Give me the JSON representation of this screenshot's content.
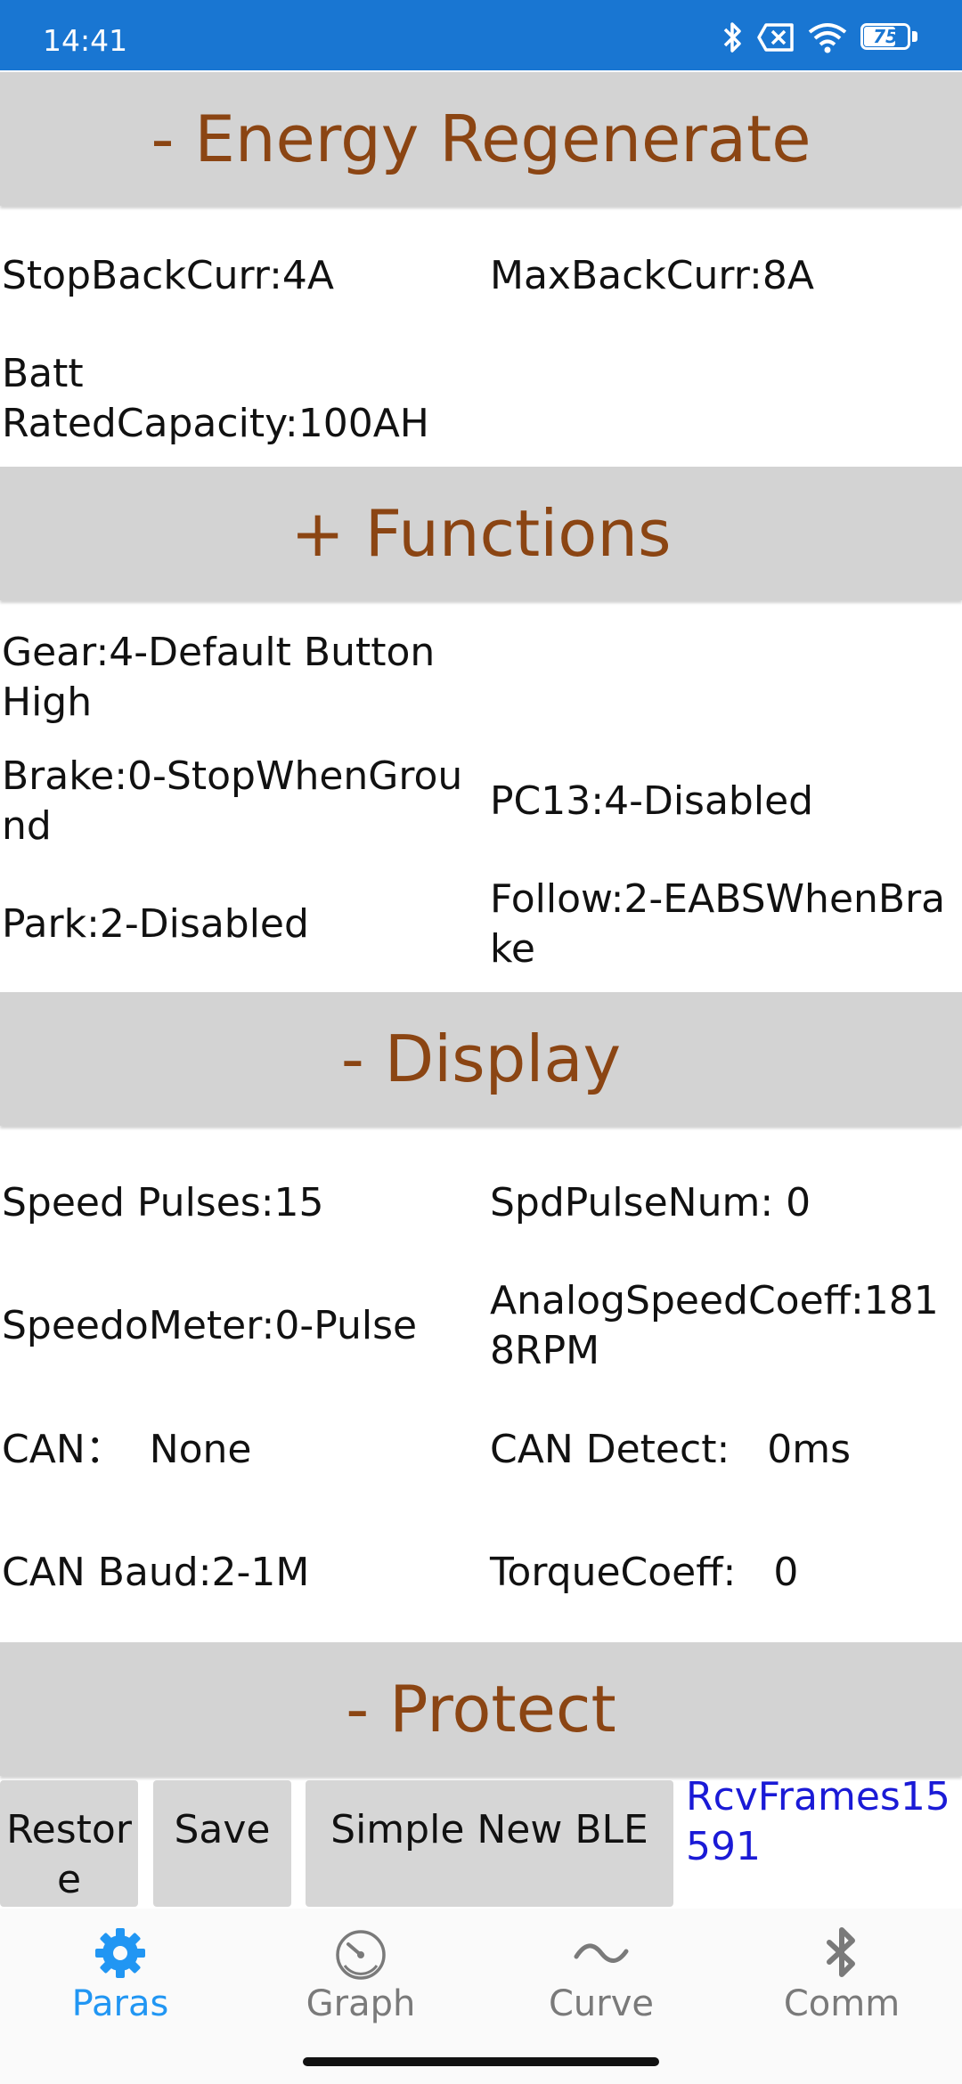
{
  "status_bar": {
    "time": "14:41",
    "battery": "75"
  },
  "sections": {
    "energy": "- Energy Regenerate",
    "functions": "+ Functions",
    "display": "- Display",
    "protect": "- Protect"
  },
  "energy": {
    "stop_back_curr": "StopBackCurr:4A",
    "max_back_curr": "MaxBackCurr:8A",
    "batt_rated_capacity": "Batt RatedCapacity:100AH"
  },
  "functions": {
    "gear": "Gear:4-Default Button High",
    "brake": "Brake:0-StopWhenGround",
    "pc13": "PC13:4-Disabled",
    "park": "Park:2-Disabled",
    "follow": "Follow:2-EABSWhenBrake"
  },
  "display": {
    "speed_pulses": "Speed Pulses:15",
    "spd_pulse_num": "SpdPulseNum:   0",
    "speedometer": "SpeedoMeter:0-Pulse",
    "analog_speed_coeff": "AnalogSpeedCoeff:1818RPM",
    "can": "CAN：  None",
    "can_detect": "CAN Detect:   0ms",
    "can_baud": "CAN Baud:2-1M",
    "torque_coeff": "TorqueCoeff:   0"
  },
  "actions": {
    "restore": "Restore",
    "save": "Save",
    "simple_new_ble": "Simple New BLE",
    "rcv_frames": "RcvFrames15591"
  },
  "bottom_nav": {
    "paras": "Paras",
    "graph": "Graph",
    "curve": "Curve",
    "comm": "Comm"
  },
  "colors": {
    "status_bar": "#1976d2",
    "section_bg": "#d3d3d3",
    "section_text": "#8b4513",
    "rcv_text": "#1a1ad6",
    "nav_active": "#2196f3"
  }
}
